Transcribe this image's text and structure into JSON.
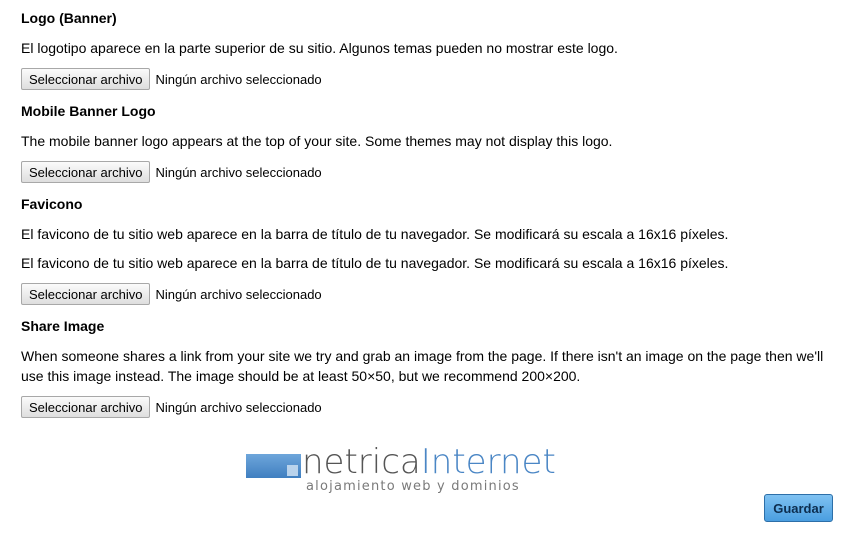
{
  "sections": [
    {
      "heading": "Logo (Banner)",
      "descriptions": [
        "El logotipo aparece en la parte superior de su sitio. Algunos temas pueden no mostrar este logo."
      ],
      "file_button": "Seleccionar archivo",
      "file_status": "Ningún archivo seleccionado"
    },
    {
      "heading": "Mobile Banner Logo",
      "descriptions": [
        "The mobile banner logo appears at the top of your site. Some themes may not display this logo."
      ],
      "file_button": "Seleccionar archivo",
      "file_status": "Ningún archivo seleccionado"
    },
    {
      "heading": "Favicono",
      "descriptions": [
        "El favicono de tu sitio web aparece en la barra de título de tu navegador. Se modificará su escala a 16x16 píxeles.",
        "El favicono de tu sitio web aparece en la barra de título de tu navegador. Se modificará su escala a 16x16 píxeles."
      ],
      "file_button": "Seleccionar archivo",
      "file_status": "Ningún archivo seleccionado"
    },
    {
      "heading": "Share Image",
      "descriptions": [
        "When someone shares a link from your site we try and grab an image from the page. If there isn't an image on the page then we'll use this image instead. The image should be at least 50×50, but we recommend 200×200."
      ],
      "file_button": "Seleccionar archivo",
      "file_status": "Ningún archivo seleccionado"
    }
  ],
  "footer": {
    "brand_part1": "netrica",
    "brand_part2": "Internet",
    "tagline": "alojamiento web y dominios",
    "save_label": "Guardar"
  }
}
